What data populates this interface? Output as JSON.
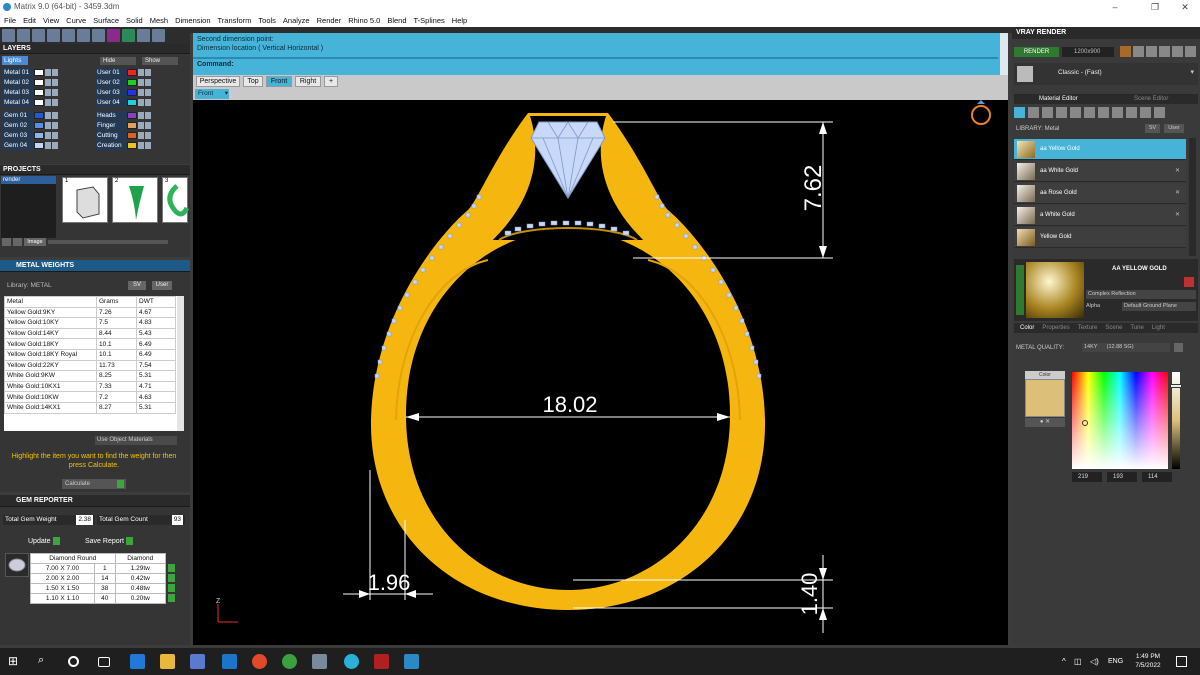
{
  "window": {
    "title": "Matrix 9.0 (64-bit) - 3459.3dm"
  },
  "menu": [
    "File",
    "Edit",
    "View",
    "Curve",
    "Surface",
    "Solid",
    "Mesh",
    "Dimension",
    "Transform",
    "Tools",
    "Analyze",
    "Render",
    "Rhino 5.0",
    "Blend",
    "T-Splines",
    "Help"
  ],
  "layers": {
    "title": "LAYERS",
    "active": "Lights",
    "hide_label": "Hide",
    "show_label": "Show",
    "left": [
      {
        "name": "Metal 01",
        "color": "#ffffff"
      },
      {
        "name": "Metal 02",
        "color": "#ffffff"
      },
      {
        "name": "Metal 03",
        "color": "#ffffff"
      },
      {
        "name": "Metal 04",
        "color": "#ffffff"
      },
      {
        "name": "Gem 01",
        "color": "#1f5cd0"
      },
      {
        "name": "Gem 02",
        "color": "#5a8ee8"
      },
      {
        "name": "Gem 03",
        "color": "#8fb5ef"
      },
      {
        "name": "Gem 04",
        "color": "#c3d6f5"
      }
    ],
    "right": [
      {
        "name": "User 01",
        "color": "#ff2020"
      },
      {
        "name": "User 02",
        "color": "#20d020"
      },
      {
        "name": "User 03",
        "color": "#2030ff"
      },
      {
        "name": "User 04",
        "color": "#20d0e0"
      },
      {
        "name": "Heads",
        "color": "#8a3fc0"
      },
      {
        "name": "Finger",
        "color": "#e0a060"
      },
      {
        "name": "Cutting",
        "color": "#e06020"
      },
      {
        "name": "Creation",
        "color": "#f0c020"
      }
    ]
  },
  "projects": {
    "title": "PROJECTS",
    "item": "render",
    "thumbs": [
      "1",
      "2",
      "3"
    ],
    "image_label": "Image"
  },
  "metal_weights": {
    "title": "METAL WEIGHTS",
    "library_label": "Library: METAL",
    "sv_label": "SV",
    "user_label": "User",
    "columns": [
      "Metal",
      "Grams",
      "DWT"
    ],
    "rows": [
      [
        "Yellow Gold:9KY",
        "7.26",
        "4.67"
      ],
      [
        "Yellow Gold:10KY",
        "7.5",
        "4.83"
      ],
      [
        "Yellow Gold:14KY",
        "8.44",
        "5.43"
      ],
      [
        "Yellow Gold:18KY",
        "10.1",
        "6.49"
      ],
      [
        "Yellow Gold:18KY Royal",
        "10.1",
        "6.49"
      ],
      [
        "Yellow Gold:22KY",
        "11.73",
        "7.54"
      ],
      [
        "White Gold:9KW",
        "8.25",
        "5.31"
      ],
      [
        "White Gold:10KX1",
        "7.33",
        "4.71"
      ],
      [
        "White Gold:10KW",
        "7.2",
        "4.63"
      ],
      [
        "White Gold:14KX1",
        "8.27",
        "5.31"
      ]
    ],
    "use_object_materials": "Use Object Materials",
    "hint": "Highlight the item you want to find the weight for then press Calculate.",
    "calculate": "Calculate"
  },
  "gem_reporter": {
    "title": "GEM REPORTER",
    "total_weight_label": "Total Gem Weight",
    "total_weight": "2.38",
    "total_count_label": "Total Gem Count",
    "total_count": "93",
    "update": "Update",
    "save_report": "Save Report",
    "columns": [
      "Diamond Round",
      "",
      "Diamond"
    ],
    "rows": [
      [
        "7.00 X 7.00",
        "1",
        "1.29tw"
      ],
      [
        "2.00 X 2.00",
        "14",
        "0.42tw"
      ],
      [
        "1.50 X 1.50",
        "38",
        "0.48tw"
      ],
      [
        "1.10 X 1.10",
        "40",
        "0.20tw"
      ]
    ]
  },
  "command": {
    "line1": "Second dimension point:",
    "line2": "Dimension location ( Vertical  Horizontal )",
    "prompt": "Command:"
  },
  "viewport_tabs": [
    "Perspective",
    "Top",
    "Front",
    "Right"
  ],
  "active_tab": "Front",
  "view_label": "Front",
  "dimensions": {
    "top_height": "7.62",
    "inner_width": "18.02",
    "shank_width": "1.96",
    "shank_thickness": "1.40"
  },
  "axis_label": "Z",
  "vray": {
    "title": "VRAY RENDER",
    "render_btn": "RENDER",
    "resolution": "1200x900",
    "preset_label": "Classic - (Fast)",
    "tabs": [
      "Material Editor",
      "Scene Editor"
    ],
    "library_label": "LIBRARY: Metal",
    "materials": [
      "aa Yellow Gold",
      "aa White Gold",
      "aa Rose Gold",
      "a White Gold",
      "Yellow Gold"
    ],
    "selected_material": "AA YELLOW GOLD",
    "reflection": "Complex Reflection",
    "alpha_label": "Alpha",
    "ground_plane": "Default Ground Plane",
    "subtabs": [
      "Color",
      "Properties",
      "Texture",
      "Scene",
      "Tune",
      "Light"
    ],
    "metal_quality_label": "METAL QUALITY:",
    "metal_quality_value": "14KY",
    "metal_quality_extra": "(12.88 SG)",
    "color_label": "Color",
    "swatch": "#dcc07a",
    "rgb": [
      "219",
      "193",
      "114"
    ]
  },
  "taskbar": {
    "language": "ENG",
    "time": "1:49 PM",
    "date": "7/5/2022"
  },
  "colors": {
    "accent": "#46b3d8",
    "gold": "#f5b70f",
    "gem": "#c8d8f8"
  }
}
